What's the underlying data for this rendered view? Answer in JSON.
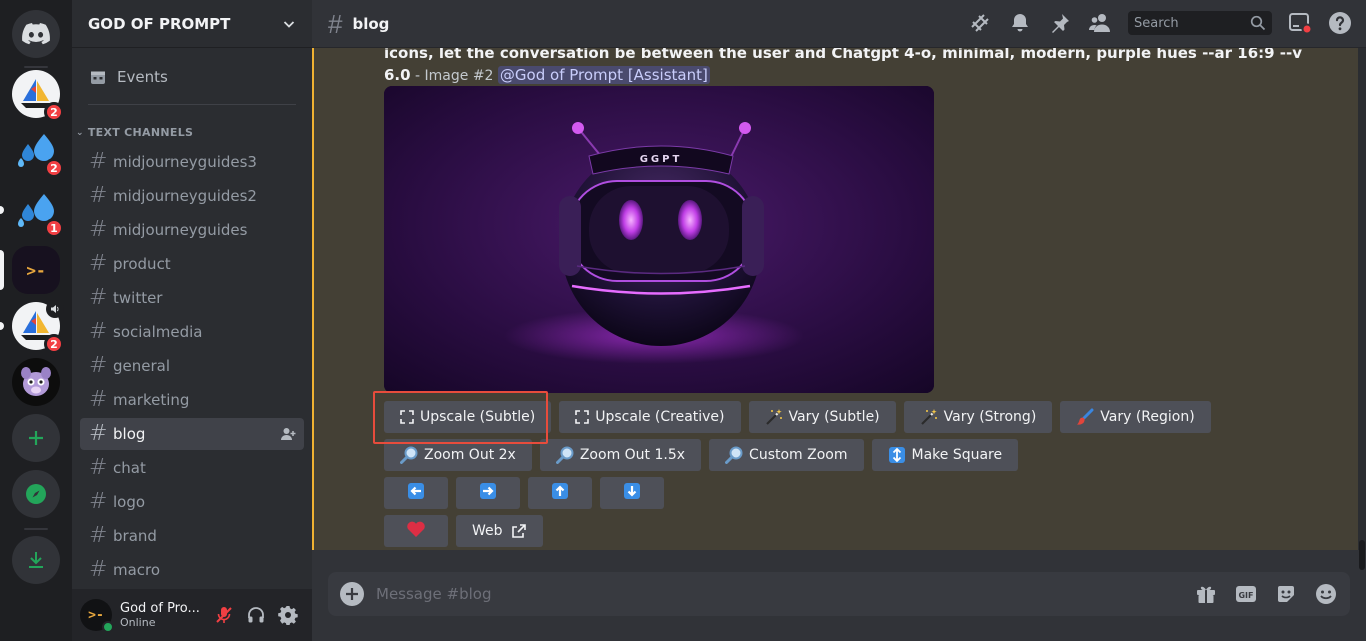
{
  "servers": [
    {
      "name": "home",
      "badge": ""
    },
    {
      "name": "sailboat-server",
      "badge": "2"
    },
    {
      "name": "droplets-server-1",
      "badge": "2"
    },
    {
      "name": "droplets-server-2",
      "badge": "1"
    },
    {
      "name": "god-of-prompt",
      "label": ">-",
      "badge": ""
    },
    {
      "name": "sailboat-server-2",
      "badge": "2"
    },
    {
      "name": "animal-server",
      "badge": ""
    }
  ],
  "guild": {
    "name": "GOD OF PROMPT"
  },
  "sidebar": {
    "events_label": "Events",
    "category": "TEXT CHANNELS",
    "channels": [
      {
        "name": "midjourneyguides3"
      },
      {
        "name": "midjourneyguides2"
      },
      {
        "name": "midjourneyguides"
      },
      {
        "name": "product"
      },
      {
        "name": "twitter"
      },
      {
        "name": "socialmedia"
      },
      {
        "name": "general"
      },
      {
        "name": "marketing"
      },
      {
        "name": "blog"
      },
      {
        "name": "chat"
      },
      {
        "name": "logo"
      },
      {
        "name": "brand"
      },
      {
        "name": "macro"
      }
    ],
    "active_channel": "blog"
  },
  "user": {
    "name": "God of Pro...",
    "avatar_text": ">-",
    "status": "Online"
  },
  "topbar": {
    "channel": "blog",
    "search_placeholder": "Search"
  },
  "message": {
    "prompt_text": "icons, let the conversation be between the user and Chatgpt 4-o, minimal, modern, purple hues --ar 16:9 --v 6.0",
    "suffix": " - Image #2 ",
    "mention": "@God of Prompt [Assistant]",
    "image_label": "GGPT"
  },
  "buttons": {
    "row1": [
      {
        "label": "Upscale (Subtle)",
        "icon": "expand-icon"
      },
      {
        "label": "Upscale (Creative)",
        "icon": "expand-icon"
      },
      {
        "label": "Vary (Subtle)",
        "icon": "sparkle-wand-icon"
      },
      {
        "label": "Vary (Strong)",
        "icon": "sparkle-wand-icon"
      },
      {
        "label": "Vary (Region)",
        "icon": "paintbrush-icon"
      }
    ],
    "row2": [
      {
        "label": "Zoom Out 2x",
        "icon": "magnifier-icon"
      },
      {
        "label": "Zoom Out 1.5x",
        "icon": "magnifier-icon"
      },
      {
        "label": "Custom Zoom",
        "icon": "magnifier-icon"
      },
      {
        "label": "Make Square",
        "icon": "up-down-arrow-icon"
      }
    ],
    "row3": [
      {
        "icon": "arrow-left-icon"
      },
      {
        "icon": "arrow-right-icon"
      },
      {
        "icon": "arrow-up-icon"
      },
      {
        "icon": "arrow-down-icon"
      }
    ],
    "row4": [
      {
        "icon": "heart-icon"
      },
      {
        "label": "Web",
        "icon": "external-link-icon"
      }
    ]
  },
  "composer": {
    "placeholder": "Message #blog"
  },
  "colors": {
    "accent": "#5865f2",
    "highlight": "#e74c3c",
    "mention_bar": "#f0b232",
    "online": "#23a55a"
  }
}
